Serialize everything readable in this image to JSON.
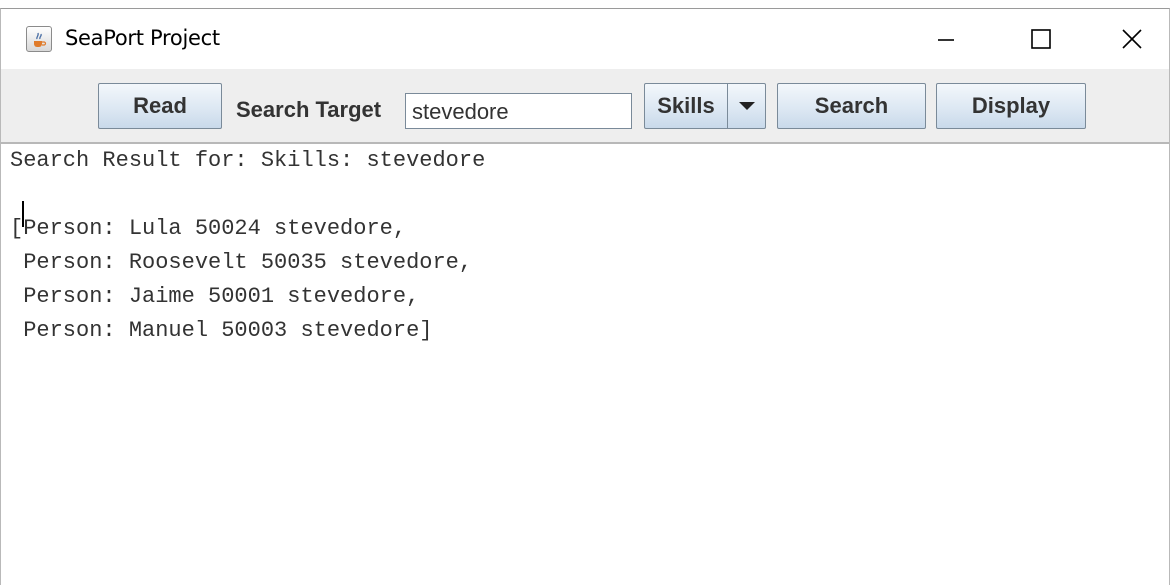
{
  "window": {
    "title": "SeaPort Project",
    "icon": "java-cup-icon"
  },
  "window_controls": {
    "minimize": "−",
    "maximize": "□",
    "close": "✕"
  },
  "toolbar": {
    "read_label": "Read",
    "search_target_label": "Search Target",
    "search_input_value": "stevedore",
    "combo_selected": "Skills",
    "search_label": "Search",
    "display_label": "Display"
  },
  "output": {
    "lines": [
      "Search Result for: Skills: stevedore",
      "",
      "[Person: Lula 50024 stevedore,",
      " Person: Roosevelt 50035 stevedore,",
      " Person: Jaime 50001 stevedore,",
      " Person: Manuel 50003 stevedore]"
    ]
  },
  "colors": {
    "toolbar_bg": "#eeeeee",
    "button_gradient_top": "#f3f7fb",
    "button_gradient_bottom": "#c9d9ea",
    "text": "#333333"
  }
}
